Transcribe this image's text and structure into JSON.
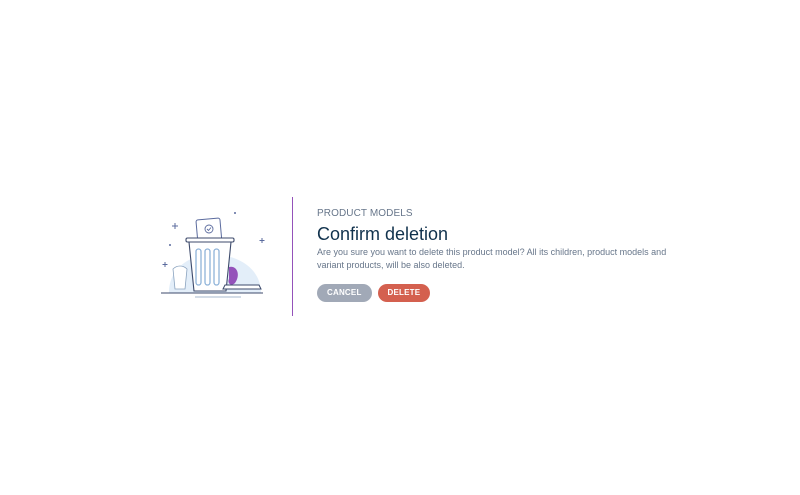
{
  "modal": {
    "subtitle": "PRODUCT MODELS",
    "title": "Confirm deletion",
    "description": "Are you sure you want to delete this product model? All its children, product models and variant products, will be also deleted.",
    "illustration_icon": "trash-can-icon"
  },
  "actions": {
    "cancel_label": "CANCEL",
    "delete_label": "DELETE"
  },
  "colors": {
    "accent": "#9452ba",
    "title": "#11324d",
    "text": "#67768a",
    "cancel": "#a1a9b7",
    "delete": "#d4604f"
  }
}
